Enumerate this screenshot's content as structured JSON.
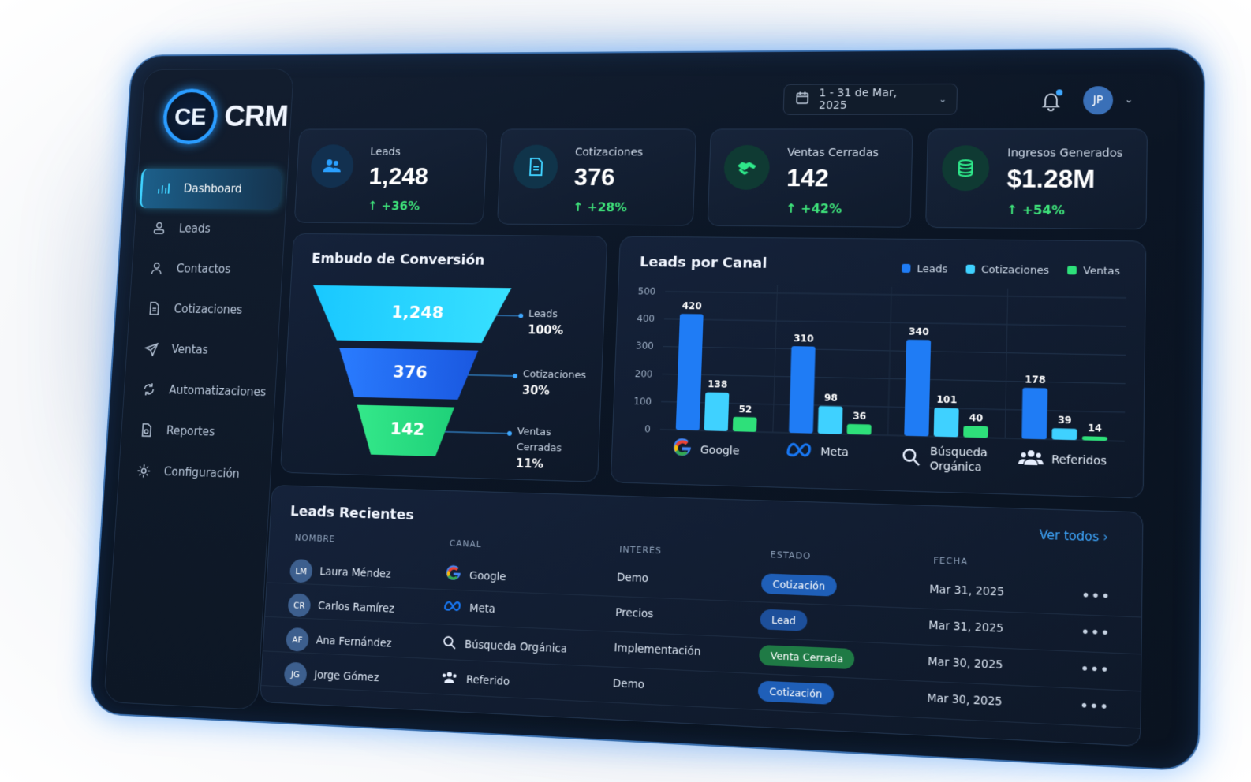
{
  "brand": {
    "mark": "CE",
    "name": "CRM"
  },
  "sidebar": {
    "items": [
      {
        "label": "Dashboard",
        "icon": "bar-chart-icon",
        "active": true
      },
      {
        "label": "Leads",
        "icon": "user-icon"
      },
      {
        "label": "Contactos",
        "icon": "contact-icon"
      },
      {
        "label": "Cotizaciones",
        "icon": "document-icon"
      },
      {
        "label": "Ventas",
        "icon": "send-icon"
      },
      {
        "label": "Automatizaciones",
        "icon": "automation-icon"
      },
      {
        "label": "Reportes",
        "icon": "report-icon"
      },
      {
        "label": "Configuración",
        "icon": "gear-icon"
      }
    ]
  },
  "header": {
    "date_range": "1 - 31 de Mar, 2025",
    "user_initials": "JP"
  },
  "kpis": [
    {
      "label": "Leads",
      "value": "1,248",
      "delta": "+36%",
      "icon": "users-icon",
      "color": "#2aa0ff"
    },
    {
      "label": "Cotizaciones",
      "value": "376",
      "delta": "+28%",
      "icon": "document-icon",
      "color": "#3fd1ff"
    },
    {
      "label": "Ventas Cerradas",
      "value": "142",
      "delta": "+42%",
      "icon": "handshake-icon",
      "color": "#2ee88a"
    },
    {
      "label": "Ingresos Generados",
      "value": "$1.28M",
      "delta": "+54%",
      "icon": "coins-icon",
      "color": "#2ee88a"
    }
  ],
  "funnel": {
    "title": "Embudo de Conversión",
    "stages": [
      {
        "value": "1,248",
        "label": "Leads",
        "pct": "100%"
      },
      {
        "value": "376",
        "label": "Cotizaciones",
        "pct": "30%"
      },
      {
        "value": "142",
        "label": "Ventas Cerradas",
        "pct": "11%"
      }
    ]
  },
  "chart_data": {
    "type": "bar",
    "title": "Leads por Canal",
    "categories": [
      "Google",
      "Meta",
      "Búsqueda Orgánica",
      "Referidos"
    ],
    "series": [
      {
        "name": "Leads",
        "values": [
          420,
          310,
          340,
          178
        ],
        "color": "#1f7cf5"
      },
      {
        "name": "Cotizaciones",
        "values": [
          138,
          98,
          101,
          39
        ],
        "color": "#3fd1ff"
      },
      {
        "name": "Ventas",
        "values": [
          52,
          36,
          40,
          14
        ],
        "color": "#2ee07a"
      }
    ],
    "ylim": [
      0,
      500
    ],
    "yticks": [
      0,
      100,
      200,
      300,
      400,
      500
    ],
    "grid": true,
    "legend": "top-right"
  },
  "recent": {
    "title": "Leads Recientes",
    "see_all": "Ver todos",
    "columns": [
      "NOMBRE",
      "CANAL",
      "INTERÉS",
      "ESTADO",
      "FECHA"
    ],
    "rows": [
      {
        "initials": "LM",
        "name": "Laura Méndez",
        "channel": "Google",
        "channel_icon": "google-icon",
        "interest": "Demo",
        "status": "Cotización",
        "status_color": "#1f5fb8",
        "date": "Mar 31, 2025"
      },
      {
        "initials": "CR",
        "name": "Carlos Ramírez",
        "channel": "Meta",
        "channel_icon": "meta-icon",
        "interest": "Precios",
        "status": "Lead",
        "status_color": "#1d4f9a",
        "date": "Mar 31, 2025"
      },
      {
        "initials": "AF",
        "name": "Ana Fernández",
        "channel": "Búsqueda Orgánica",
        "channel_icon": "search-icon",
        "interest": "Implementación",
        "status": "Venta Cerrada",
        "status_color": "#1f7a45",
        "date": "Mar 30, 2025"
      },
      {
        "initials": "JG",
        "name": "Jorge Gómez",
        "channel": "Referido",
        "channel_icon": "users-icon",
        "interest": "Demo",
        "status": "Cotización",
        "status_color": "#1f5fb8",
        "date": "Mar 30, 2025"
      }
    ]
  }
}
